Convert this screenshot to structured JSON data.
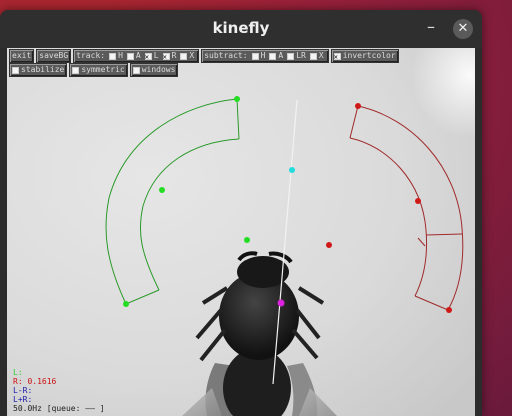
{
  "window": {
    "title": "kinefly",
    "minimize_glyph": "–",
    "close_glyph": "✕"
  },
  "toolbar": {
    "row1": [
      {
        "type": "button",
        "label": "exit",
        "name": "exit-button"
      },
      {
        "type": "button",
        "label": "saveBG",
        "name": "savebg-button"
      },
      {
        "type": "group",
        "label": "track:",
        "name": "track-group",
        "items": [
          {
            "label": "H",
            "checked": false
          },
          {
            "label": "A",
            "checked": false
          },
          {
            "label": "L",
            "checked": true
          },
          {
            "label": "R",
            "checked": true
          },
          {
            "label": "X",
            "checked": false
          }
        ]
      },
      {
        "type": "group",
        "label": "subtract:",
        "name": "subtract-group",
        "items": [
          {
            "label": "H",
            "checked": false
          },
          {
            "label": "A",
            "checked": false
          },
          {
            "label": "LR",
            "checked": false
          },
          {
            "label": "X",
            "checked": false
          }
        ]
      },
      {
        "type": "check",
        "label": "invertcolor",
        "checked": true,
        "name": "invertcolor-checkbox"
      }
    ],
    "row2": [
      {
        "type": "check",
        "label": "stabilize",
        "checked": false,
        "name": "stabilize-checkbox"
      },
      {
        "type": "check",
        "label": "symmetric",
        "checked": false,
        "name": "symmetric-checkbox"
      },
      {
        "type": "check",
        "label": "windows",
        "checked": false,
        "name": "windows-checkbox"
      }
    ]
  },
  "readout": {
    "lines": [
      {
        "text": "L:",
        "color": "#33cc33"
      },
      {
        "text": "R: 0.1616",
        "color": "#cc1111"
      },
      {
        "text": "L-R:",
        "color": "#1a1aaa"
      },
      {
        "text": "L+R:",
        "color": "#1a1aaa"
      },
      {
        "text": "50.0Hz [queue: ——     ]",
        "color": "#222222"
      }
    ]
  },
  "colors": {
    "left_wing": "#2a9a2a",
    "right_wing": "#a02a2a",
    "left_handle": "#22dd22",
    "right_handle": "#d01818",
    "head_handle": "#22dddd",
    "abdomen_handle": "#dd22dd"
  }
}
